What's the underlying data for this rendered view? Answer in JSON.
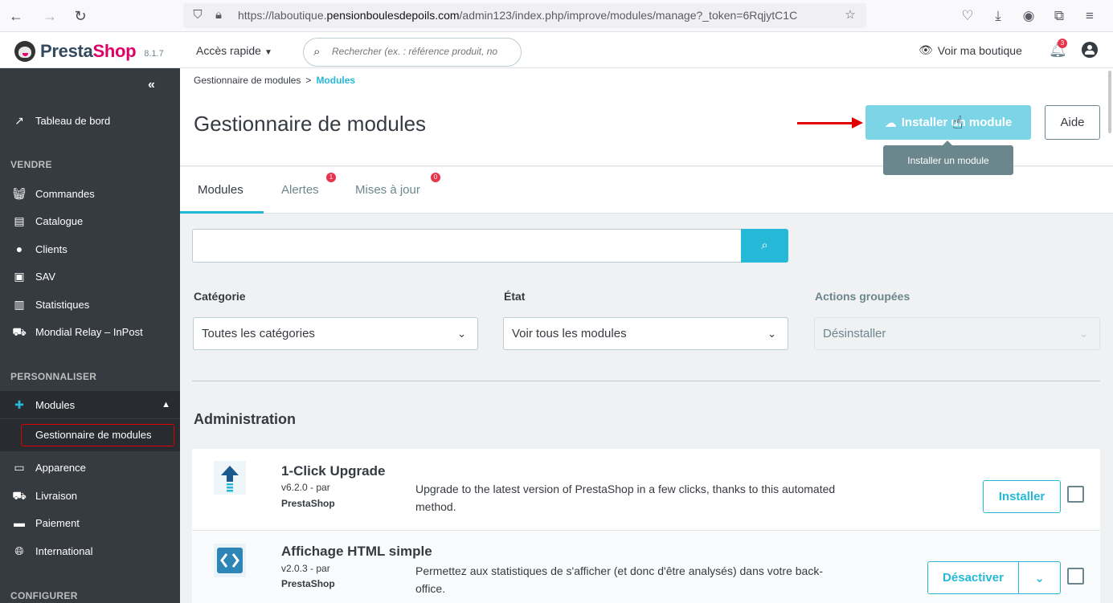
{
  "browser": {
    "url_prefix": "https://laboutique.",
    "url_domain": "pensionboulesdepoils.com",
    "url_rest": "/admin123/index.php/improve/modules/manage?_token=6RqjytC1C"
  },
  "header": {
    "logo_presta": "Presta",
    "logo_shop": "Shop",
    "version": "8.1.7",
    "quick_access": "Accès rapide",
    "search_placeholder": "Rechercher (ex. : référence produit, no",
    "shop_link": "Voir ma boutique",
    "notif_count": "3"
  },
  "sidebar": {
    "dashboard": "Tableau de bord",
    "section_sell": "VENDRE",
    "sell_items": [
      "Commandes",
      "Catalogue",
      "Clients",
      "SAV",
      "Statistiques",
      "Mondial Relay – InPost"
    ],
    "section_customize": "PERSONNALISER",
    "modules": "Modules",
    "modules_sub": "Gestionnaire de modules",
    "customize_items": [
      "Apparence",
      "Livraison",
      "Paiement",
      "International"
    ],
    "section_configure": "CONFIGURER"
  },
  "page": {
    "breadcrumb_parent": "Gestionnaire de modules",
    "breadcrumb_sep": ">",
    "breadcrumb_current": "Modules",
    "title": "Gestionnaire de modules",
    "install_button": "Installer un module",
    "help_button": "Aide",
    "tooltip": "Installer un module"
  },
  "tabs": [
    {
      "label": "Modules"
    },
    {
      "label": "Alertes",
      "badge": "1"
    },
    {
      "label": "Mises à jour",
      "badge": "0"
    }
  ],
  "filters": {
    "category_label": "Catégorie",
    "category_value": "Toutes les catégories",
    "state_label": "État",
    "state_value": "Voir tous les modules",
    "bulk_label": "Actions groupées",
    "bulk_value": "Désinstaller"
  },
  "section": "Administration",
  "modules": [
    {
      "name": "1-Click Upgrade",
      "version": "v6.2.0 - par",
      "author": "PrestaShop",
      "description": "Upgrade to the latest version of PrestaShop in a few clicks, thanks to this automated method.",
      "action": "Installer"
    },
    {
      "name": "Affichage HTML simple",
      "version": "v2.0.3 - par",
      "author": "PrestaShop",
      "description": "Permettez aux statistiques de s'afficher (et donc d'être analysés) dans votre back-office.",
      "action": "Désactiver"
    }
  ],
  "colors": {
    "accent": "#25b9d7",
    "sidebar": "#363a41",
    "brand_pink": "#df0067",
    "badge_red": "#e7344a",
    "highlight_red": "#e00000"
  }
}
